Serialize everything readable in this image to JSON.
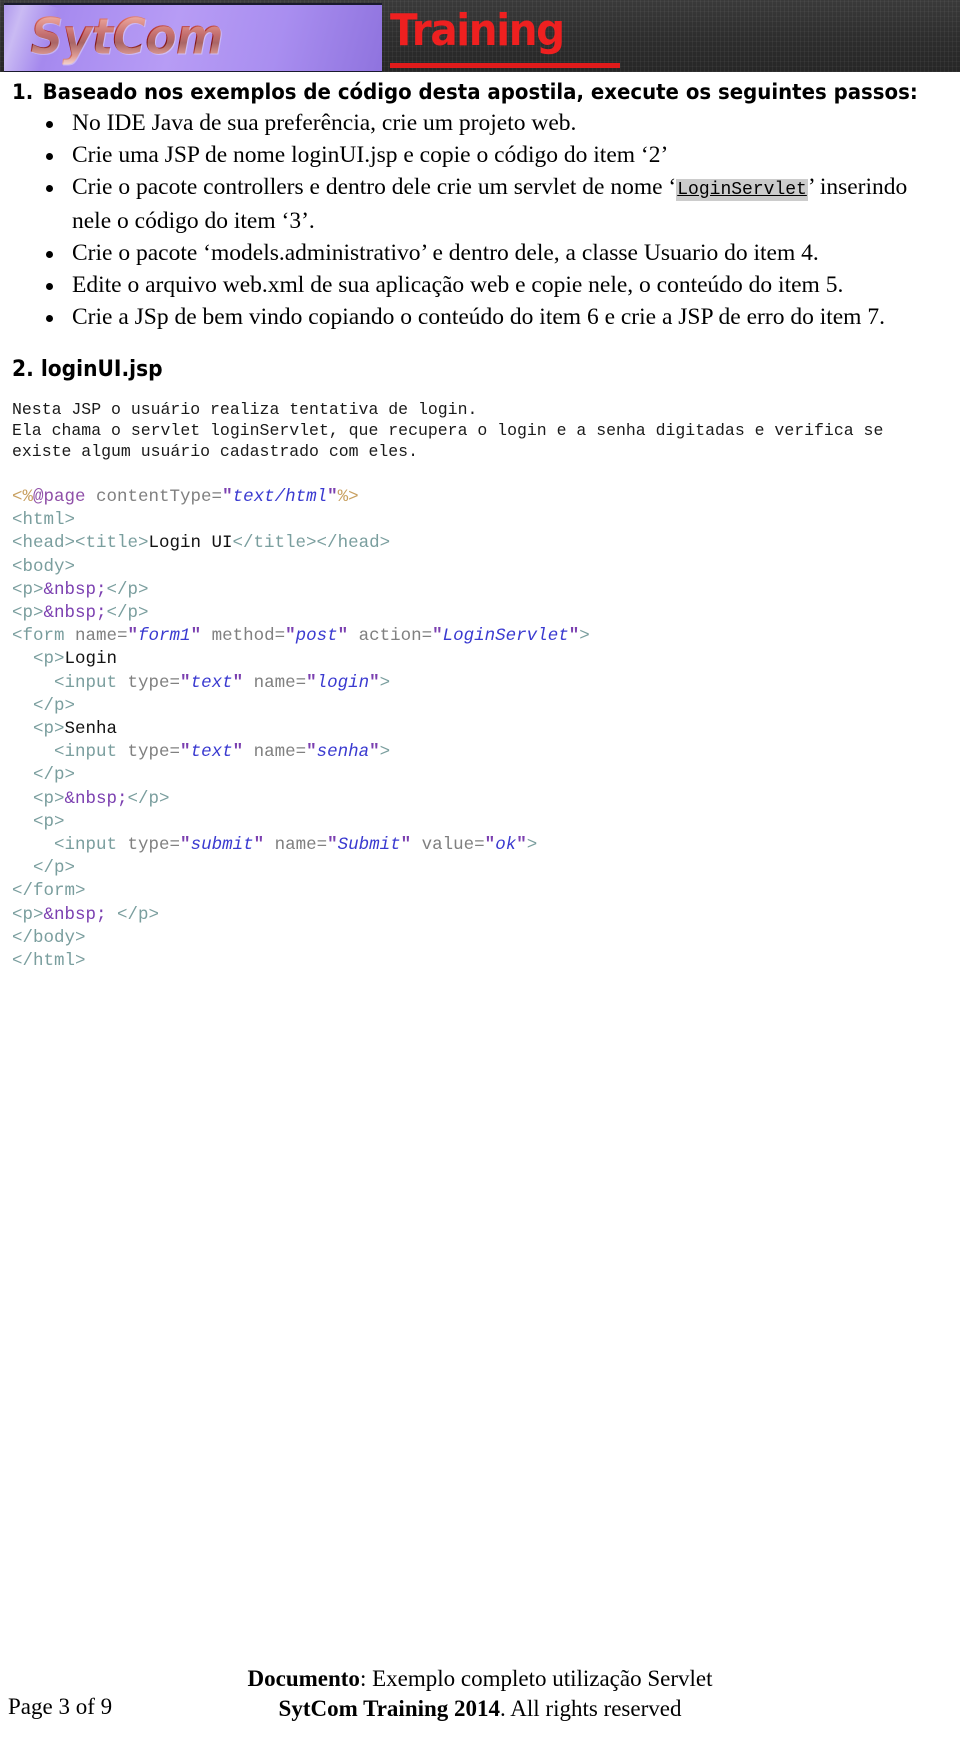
{
  "header": {
    "logo_text": "SytCom",
    "training_text": "Training",
    "logo_bg_color": "#a88cf0",
    "banner_bg_color": "#2e2e2e",
    "training_color": "#ef2020"
  },
  "section1": {
    "number": "1.",
    "title": "Baseado nos exemplos de código desta apostila, execute os seguintes passos:",
    "bullets": [
      {
        "parts": [
          {
            "type": "text",
            "text": "No IDE Java de sua preferência, crie um projeto web."
          }
        ]
      },
      {
        "parts": [
          {
            "type": "text",
            "text": "Crie uma JSP de nome loginUI.jsp e copie o código do item ‘2’"
          }
        ]
      },
      {
        "parts": [
          {
            "type": "text",
            "text": "Crie o pacote controllers e dentro dele crie um servlet de nome ‘"
          },
          {
            "type": "code",
            "text": "LoginServlet"
          },
          {
            "type": "text",
            "text": "’ inserindo nele o código do item ‘3’."
          }
        ]
      },
      {
        "parts": [
          {
            "type": "text",
            "text": "Crie o pacote ‘models.administrativo’ e dentro dele, a classe Usuario do item 4."
          }
        ]
      },
      {
        "parts": [
          {
            "type": "text",
            "text": "Edite o arquivo web.xml de sua aplicação web e copie nele, o conteúdo do item 5."
          }
        ]
      },
      {
        "parts": [
          {
            "type": "text",
            "text": "Crie a JSp de bem vindo copiando o conteúdo do item 6 e crie a JSP de erro do item 7."
          }
        ]
      }
    ]
  },
  "section2": {
    "heading": "2. loginUI.jsp",
    "description": "Nesta JSP o usuário realiza tentativa de login.\nEla chama o servlet loginServlet, que recupera o login e a senha digitadas e verifica se\nexiste algum usuário cadastrado com eles.",
    "code_lines": [
      [
        {
          "c": "t-dir",
          "t": "<%"
        },
        {
          "c": "t-dirname",
          "t": "@page"
        },
        {
          "c": "t-attr",
          "t": " contentType="
        },
        {
          "c": "t-quote",
          "t": "\""
        },
        {
          "c": "t-val",
          "t": "text/html"
        },
        {
          "c": "t-quote",
          "t": "\""
        },
        {
          "c": "t-dir",
          "t": "%>"
        }
      ],
      [
        {
          "c": "t-tag",
          "t": "<html>"
        }
      ],
      [
        {
          "c": "t-tag",
          "t": "<head><title>"
        },
        {
          "c": "t-txt",
          "t": "Login UI"
        },
        {
          "c": "t-tag",
          "t": "</title></head>"
        }
      ],
      [
        {
          "c": "t-tag",
          "t": "<body>"
        }
      ],
      [
        {
          "c": "t-tag",
          "t": "<p>"
        },
        {
          "c": "t-ent",
          "t": "&nbsp;"
        },
        {
          "c": "t-tag",
          "t": "</p>"
        }
      ],
      [
        {
          "c": "t-tag",
          "t": "<p>"
        },
        {
          "c": "t-ent",
          "t": "&nbsp;"
        },
        {
          "c": "t-tag",
          "t": "</p>"
        }
      ],
      [
        {
          "c": "t-tag",
          "t": "<form"
        },
        {
          "c": "t-attr",
          "t": " name="
        },
        {
          "c": "t-quote",
          "t": "\""
        },
        {
          "c": "t-val",
          "t": "form1"
        },
        {
          "c": "t-quote",
          "t": "\""
        },
        {
          "c": "t-attr",
          "t": " method="
        },
        {
          "c": "t-quote",
          "t": "\""
        },
        {
          "c": "t-val",
          "t": "post"
        },
        {
          "c": "t-quote",
          "t": "\""
        },
        {
          "c": "t-attr",
          "t": " action="
        },
        {
          "c": "t-quote",
          "t": "\""
        },
        {
          "c": "t-val",
          "t": "LoginServlet"
        },
        {
          "c": "t-quote",
          "t": "\""
        },
        {
          "c": "t-tag",
          "t": ">"
        }
      ],
      [
        {
          "c": "t-tag",
          "t": "  <p>"
        },
        {
          "c": "t-txt",
          "t": "Login"
        }
      ],
      [
        {
          "c": "t-tag",
          "t": "    <input"
        },
        {
          "c": "t-attr",
          "t": " type="
        },
        {
          "c": "t-quote",
          "t": "\""
        },
        {
          "c": "t-val",
          "t": "text"
        },
        {
          "c": "t-quote",
          "t": "\""
        },
        {
          "c": "t-attr",
          "t": " name="
        },
        {
          "c": "t-quote",
          "t": "\""
        },
        {
          "c": "t-val",
          "t": "login"
        },
        {
          "c": "t-quote",
          "t": "\""
        },
        {
          "c": "t-tag",
          "t": ">"
        }
      ],
      [
        {
          "c": "t-tag",
          "t": "  </p>"
        }
      ],
      [
        {
          "c": "t-tag",
          "t": "  <p>"
        },
        {
          "c": "t-txt",
          "t": "Senha"
        }
      ],
      [
        {
          "c": "t-tag",
          "t": "    <input"
        },
        {
          "c": "t-attr",
          "t": " type="
        },
        {
          "c": "t-quote",
          "t": "\""
        },
        {
          "c": "t-val",
          "t": "text"
        },
        {
          "c": "t-quote",
          "t": "\""
        },
        {
          "c": "t-attr",
          "t": " name="
        },
        {
          "c": "t-quote",
          "t": "\""
        },
        {
          "c": "t-val",
          "t": "senha"
        },
        {
          "c": "t-quote",
          "t": "\""
        },
        {
          "c": "t-tag",
          "t": ">"
        }
      ],
      [
        {
          "c": "t-tag",
          "t": "  </p>"
        }
      ],
      [
        {
          "c": "t-tag",
          "t": "  <p>"
        },
        {
          "c": "t-ent",
          "t": "&nbsp;"
        },
        {
          "c": "t-tag",
          "t": "</p>"
        }
      ],
      [
        {
          "c": "t-tag",
          "t": "  <p>"
        }
      ],
      [
        {
          "c": "t-tag",
          "t": "    <input"
        },
        {
          "c": "t-attr",
          "t": " type="
        },
        {
          "c": "t-quote",
          "t": "\""
        },
        {
          "c": "t-val",
          "t": "submit"
        },
        {
          "c": "t-quote",
          "t": "\""
        },
        {
          "c": "t-attr",
          "t": " name="
        },
        {
          "c": "t-quote",
          "t": "\""
        },
        {
          "c": "t-val",
          "t": "Submit"
        },
        {
          "c": "t-quote",
          "t": "\""
        },
        {
          "c": "t-attr",
          "t": " value="
        },
        {
          "c": "t-quote",
          "t": "\""
        },
        {
          "c": "t-val",
          "t": "ok"
        },
        {
          "c": "t-quote",
          "t": "\""
        },
        {
          "c": "t-tag",
          "t": ">"
        }
      ],
      [
        {
          "c": "t-tag",
          "t": "  </p>"
        }
      ],
      [
        {
          "c": "t-tag",
          "t": "</form>"
        }
      ],
      [
        {
          "c": "t-tag",
          "t": "<p>"
        },
        {
          "c": "t-ent",
          "t": "&nbsp;"
        },
        {
          "c": "t-tag",
          "t": " </p>"
        }
      ],
      [
        {
          "c": "t-tag",
          "t": "</body>"
        }
      ],
      [
        {
          "c": "t-tag",
          "t": "</html>"
        }
      ]
    ]
  },
  "footer": {
    "page_label": "Page 3 of 9",
    "doc_label": "Documento",
    "doc_title": ": Exemplo completo utilização Servlet",
    "company": "SytCom Training 2014",
    "rights": ". All rights reserved"
  }
}
